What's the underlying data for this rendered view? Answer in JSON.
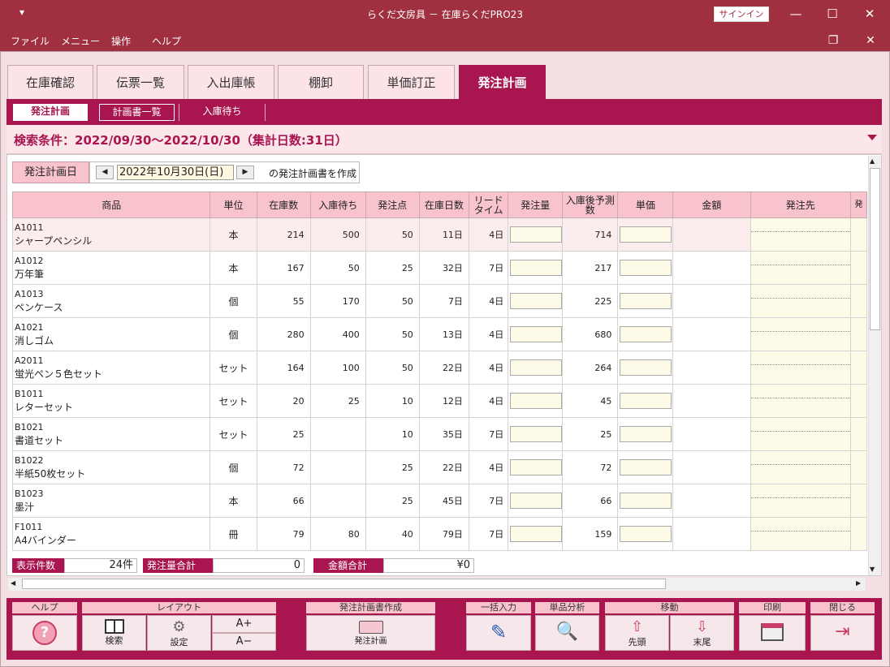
{
  "window": {
    "title": "らくだ文房具 － 在庫らくだPRO23",
    "signin": "サインイン",
    "sys_icon": "▾",
    "min": "—",
    "max": "☐",
    "close": "✕",
    "mdi_restore": "❐",
    "mdi_close": "✕"
  },
  "menu": [
    "ファイル",
    "メニュー",
    "操作",
    "ヘルプ"
  ],
  "tabs": [
    "在庫確認",
    "伝票一覧",
    "入出庫帳",
    "棚卸",
    "単価訂正",
    "発注計画"
  ],
  "subtabs": [
    "発注計画",
    "計画書一覧",
    "入庫待ち"
  ],
  "condition": "検索条件：2022/09/30～2022/10/30（集計日数:31日）",
  "date": {
    "label": "発注計画日",
    "value": "2022年10月30日(日)",
    "suffix": "の発注計画書を作成",
    "prev": "◀",
    "next": "▶"
  },
  "columns": [
    "商品",
    "単位",
    "在庫数",
    "入庫待ち",
    "発注点",
    "在庫日数",
    "リードタイム",
    "発注量",
    "入庫後予測数",
    "単価",
    "金額",
    "発注先",
    "発"
  ],
  "rows": [
    {
      "code": "A1011",
      "name": "シャープペンシル",
      "unit": "本",
      "stock": "214",
      "waiting": "500",
      "point": "50",
      "days": "11日",
      "lead": "4日",
      "forecast": "714"
    },
    {
      "code": "A1012",
      "name": "万年筆",
      "unit": "本",
      "stock": "167",
      "waiting": "50",
      "point": "25",
      "days": "32日",
      "lead": "7日",
      "forecast": "217"
    },
    {
      "code": "A1013",
      "name": "ペンケース",
      "unit": "個",
      "stock": "55",
      "waiting": "170",
      "point": "50",
      "days": "7日",
      "lead": "4日",
      "forecast": "225"
    },
    {
      "code": "A1021",
      "name": "消しゴム",
      "unit": "個",
      "stock": "280",
      "waiting": "400",
      "point": "50",
      "days": "13日",
      "lead": "4日",
      "forecast": "680"
    },
    {
      "code": "A2011",
      "name": "蛍光ペン５色セット",
      "unit": "セット",
      "stock": "164",
      "waiting": "100",
      "point": "50",
      "days": "22日",
      "lead": "4日",
      "forecast": "264"
    },
    {
      "code": "B1011",
      "name": "レターセット",
      "unit": "セット",
      "stock": "20",
      "waiting": "25",
      "point": "10",
      "days": "12日",
      "lead": "4日",
      "forecast": "45"
    },
    {
      "code": "B1021",
      "name": "書道セット",
      "unit": "セット",
      "stock": "25",
      "waiting": "",
      "point": "10",
      "days": "35日",
      "lead": "7日",
      "forecast": "25"
    },
    {
      "code": "B1022",
      "name": "半紙50枚セット",
      "unit": "個",
      "stock": "72",
      "waiting": "",
      "point": "25",
      "days": "22日",
      "lead": "4日",
      "forecast": "72"
    },
    {
      "code": "B1023",
      "name": "墨汁",
      "unit": "本",
      "stock": "66",
      "waiting": "",
      "point": "25",
      "days": "45日",
      "lead": "7日",
      "forecast": "66"
    },
    {
      "code": "F1011",
      "name": "A4バインダー",
      "unit": "冊",
      "stock": "79",
      "waiting": "80",
      "point": "40",
      "days": "79日",
      "lead": "7日",
      "forecast": "159"
    }
  ],
  "summary": {
    "count_label": "表示件数",
    "count": "24件",
    "qty_label": "発注量合計",
    "qty": "0",
    "amount_label": "金額合計",
    "amount": "¥0"
  },
  "footer": {
    "help": {
      "group": "ヘルプ",
      "icon": "?"
    },
    "layout": {
      "group": "レイアウト",
      "search": "検索",
      "settings": "設定",
      "font_up": "A+",
      "font_down": "A−"
    },
    "plan": {
      "group": "発注計画書作成",
      "label": "発注計画"
    },
    "bulk": {
      "group": "一括入力"
    },
    "analysis": {
      "group": "単品分析"
    },
    "move": {
      "group": "移動",
      "first": "先頭",
      "last": "末尾"
    },
    "print": {
      "group": "印刷"
    },
    "close": {
      "group": "閉じる"
    }
  }
}
